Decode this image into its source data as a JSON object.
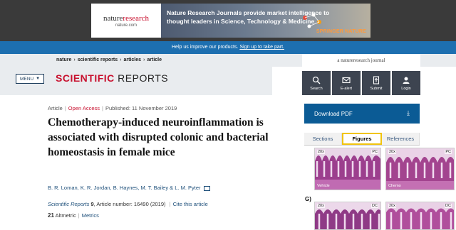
{
  "ad": {
    "brand_main": "nature",
    "brand_sub": "research",
    "site": "nature.com",
    "headline": "Nature Research Journals provide market intelligence to thought leaders in Science, Technology & Medicine",
    "sponsor": "SPRINGER NATURE"
  },
  "survey": {
    "text": "Help us improve our products.",
    "link": "Sign up to take part."
  },
  "breadcrumb": [
    "nature",
    "scientific reports",
    "articles",
    "article"
  ],
  "journal_tag": "a natureresearch journal",
  "header": {
    "menu_label": "MENU",
    "title_bold": "SCIENTIFIC",
    "title_rest": "REPORTS"
  },
  "toolbar": {
    "search": "Search",
    "email": "E-alert",
    "submit": "Submit",
    "login": "Login"
  },
  "download": {
    "label": "Download PDF"
  },
  "tabs": [
    "Sections",
    "Figures",
    "References"
  ],
  "figures": {
    "label_g": "G)",
    "t1_tl": "20x",
    "t1_tr": "PC",
    "t1_bl": "Vehicle",
    "t2_tl": "20x",
    "t2_tr": "PC",
    "t2_bl": "Chemo",
    "t3_tl": "20x",
    "t3_tr": "DC",
    "t4_tl": "20x",
    "t4_tr": "DC"
  },
  "article": {
    "type": "Article",
    "access": "Open Access",
    "published": "Published: 11 November 2019",
    "title": "Chemotherapy-induced neuroinflammation is associated with disrupted colonic and bacterial homeostasis in female mice",
    "authors": "B. R. Loman, K. R. Jordan, B. Haynes, M. T. Bailey & L. M. Pyter",
    "journal": "Scientific Reports",
    "volume": "9",
    "article_number": ", Article number: 16490 (2019)",
    "cite": "Cite this article",
    "altmetric_count": "21",
    "altmetric_label": "Altmetric",
    "metrics_label": "Metrics"
  }
}
